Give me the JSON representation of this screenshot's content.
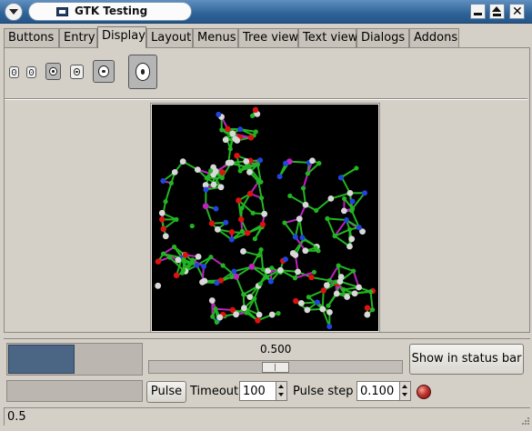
{
  "window": {
    "title": "GTK Testing",
    "controls": [
      "window-menu",
      "minimize",
      "maximize",
      "close"
    ]
  },
  "notebook": {
    "tabs": [
      {
        "label": "Buttons",
        "active": false
      },
      {
        "label": "Entry",
        "active": false
      },
      {
        "label": "Display",
        "active": true
      },
      {
        "label": "Layout",
        "active": false
      },
      {
        "label": "Menus",
        "active": false
      },
      {
        "label": "Tree view",
        "active": false
      },
      {
        "label": "Text view",
        "active": false
      },
      {
        "label": "Dialogs",
        "active": false
      },
      {
        "label": "Addons",
        "active": false
      }
    ]
  },
  "display": {
    "icon_sizes": [
      "menu",
      "small-toolbar",
      "large-toolbar",
      "button",
      "dnd",
      "dialog"
    ],
    "image_subject": "molecule-structure",
    "palette": {
      "carbon": "#22b422",
      "hydrogen": "#d8d8d8",
      "nitrogen": "#2244dd",
      "oxygen": "#dd1111",
      "phosphorus": "#c020c0",
      "background": "#000000"
    }
  },
  "controls": {
    "progress_fraction": 0.5,
    "scale_value": "0.500",
    "scale_fraction": 0.5,
    "show_in_status_label": "Show in status bar",
    "pulse_label": "Pulse",
    "timeout_label": "Timeout",
    "timeout_value": "100",
    "pulse_step_label": "Pulse step",
    "pulse_step_value": "0.100",
    "led_color": "#c0352b"
  },
  "statusbar": {
    "text": "0.5"
  }
}
